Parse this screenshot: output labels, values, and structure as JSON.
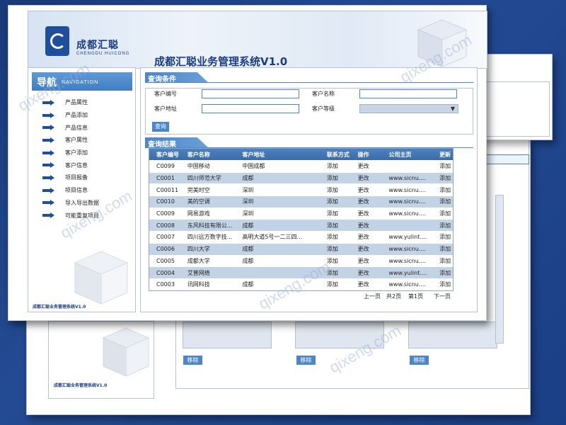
{
  "colors": {
    "accent": "#4b86c8",
    "brand": "#1f4f9c",
    "row_alt": "#c3d3e6",
    "background": "#1f428a"
  },
  "brand": {
    "name_cn": "成都汇聪",
    "name_en": "CHENGDU HUICONG"
  },
  "system_title": "成都汇聪业务管理系统V1.0",
  "nav": {
    "title_cn": "导航",
    "title_en": "NAVIGATION",
    "items": [
      "产品属性",
      "产品添加",
      "产品信息",
      "客户属性",
      "客户添加",
      "客户信息",
      "项目报备",
      "项目信息",
      "导入导出数据",
      "可能重复项目"
    ],
    "footer": "成都汇聪业务管理系统V1.0"
  },
  "query": {
    "title": "查询条件",
    "labels": {
      "customer_id": "客户编号",
      "customer_name": "客户名称",
      "customer_address": "客户地址",
      "customer_level": "客户等级"
    },
    "button": "查询"
  },
  "results": {
    "title": "查询结果",
    "headers": [
      "客户编号",
      "客户名称",
      "客户地址",
      "联系方式",
      "操作",
      "公司主页",
      "更新"
    ],
    "rows": [
      [
        "C0099",
        "中国移动",
        "中国成都",
        "添加",
        "更改",
        "",
        "添加"
      ],
      [
        "C0001",
        "四川师范大学",
        "成都",
        "添加",
        "更改",
        "www.sicnu....",
        "添加"
      ],
      [
        "C00011",
        "完美时空",
        "深圳",
        "添加",
        "更改",
        "www.sicnu....",
        "添加"
      ],
      [
        "C0010",
        "美的空调",
        "深圳",
        "添加",
        "更改",
        "www.sicnu....",
        "添加"
      ],
      [
        "C0009",
        "网易游戏",
        "深圳",
        "添加",
        "更改",
        "www.sicnu....",
        "添加"
      ],
      [
        "C0008",
        "东风科技有限公...",
        "成都",
        "添加",
        "更改",
        "",
        "添加"
      ],
      [
        "C0007",
        "四川远方数字技...",
        "高明大道5号一二三四...",
        "添加",
        "更改",
        "www.yulint....",
        "添加"
      ],
      [
        "C0006",
        "四川大学",
        "成都",
        "添加",
        "更改",
        "www.sicnu....",
        "添加"
      ],
      [
        "C0005",
        "成都大学",
        "成都",
        "添加",
        "更改",
        "www.sicnu....",
        "添加"
      ],
      [
        "C0004",
        "艾普网络",
        "",
        "添加",
        "更改",
        "www.yulint....",
        "添加"
      ],
      [
        "C0003",
        "讯网科技",
        "成都",
        "添加",
        "更改",
        "www.sicnu....",
        "添加"
      ]
    ],
    "pager": {
      "prev": "上一页",
      "total": "共2页",
      "current": "第1页",
      "next": "下一页"
    }
  },
  "back_window": {
    "remove_label": "移除",
    "footer": "成都汇聪业务管理系统V1.0"
  },
  "watermark": "qixeng.com"
}
